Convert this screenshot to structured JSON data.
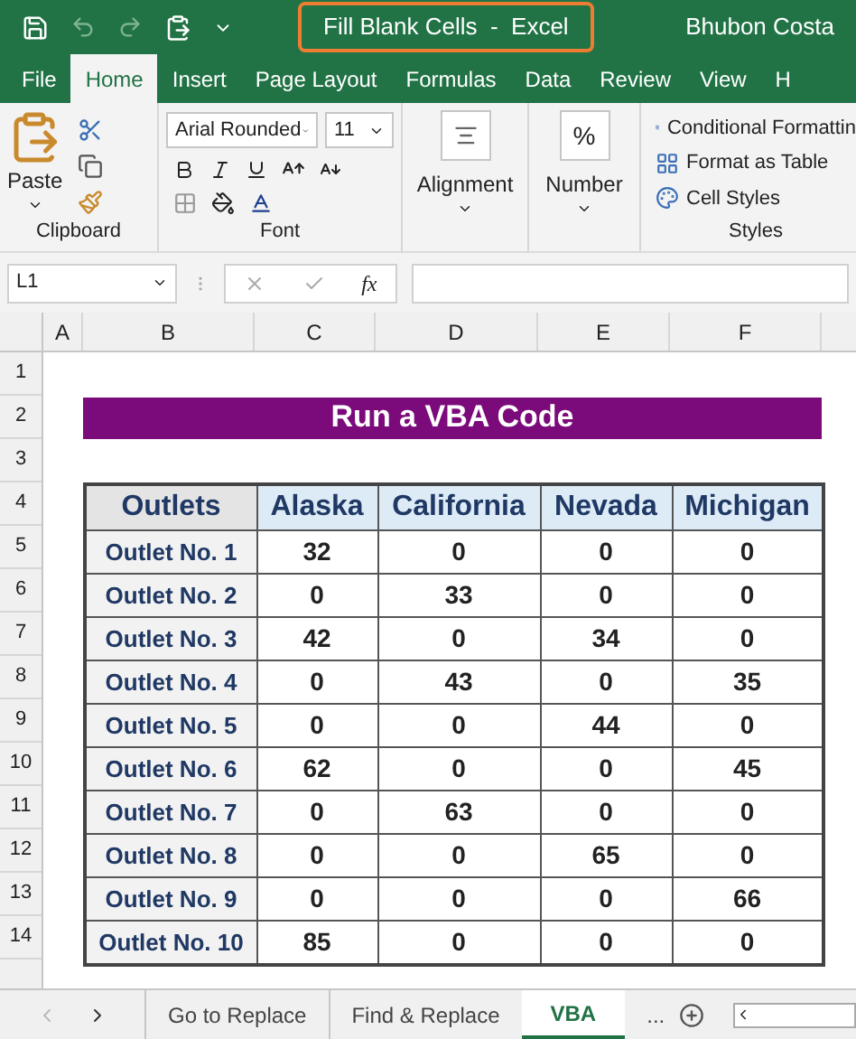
{
  "title_bar": {
    "title": "Fill Blank Cells  -  Excel",
    "user": "Bhubon Costa"
  },
  "ribbon_tabs": [
    {
      "label": "File",
      "selected": false
    },
    {
      "label": "Home",
      "selected": true
    },
    {
      "label": "Insert",
      "selected": false
    },
    {
      "label": "Page Layout",
      "selected": false
    },
    {
      "label": "Formulas",
      "selected": false
    },
    {
      "label": "Data",
      "selected": false
    },
    {
      "label": "Review",
      "selected": false
    },
    {
      "label": "View",
      "selected": false
    },
    {
      "label": "H",
      "selected": false
    }
  ],
  "ribbon": {
    "clipboard": {
      "paste": "Paste",
      "label": "Clipboard"
    },
    "font": {
      "font_name": "Arial Rounded",
      "font_size": "11",
      "label": "Font"
    },
    "alignment": {
      "label": "Alignment"
    },
    "number": {
      "symbol": "%",
      "label": "Number"
    },
    "styles": {
      "items": [
        "Conditional Formattin",
        "Format as Table",
        "Cell Styles"
      ],
      "label": "Styles"
    }
  },
  "formula_bar": {
    "name_box": "L1",
    "fx": "fx"
  },
  "column_headers": [
    "A",
    "B",
    "C",
    "D",
    "E",
    "F"
  ],
  "row_numbers": [
    "1",
    "2",
    "3",
    "4",
    "5",
    "6",
    "7",
    "8",
    "9",
    "10",
    "11",
    "12",
    "13",
    "14"
  ],
  "sheet": {
    "title": "Run a VBA Code",
    "columns": [
      "Outlets",
      "Alaska",
      "California",
      "Nevada",
      "Michigan"
    ],
    "rows": [
      [
        "Outlet No. 1",
        "32",
        "0",
        "0",
        "0"
      ],
      [
        "Outlet No. 2",
        "0",
        "33",
        "0",
        "0"
      ],
      [
        "Outlet No. 3",
        "42",
        "0",
        "34",
        "0"
      ],
      [
        "Outlet No. 4",
        "0",
        "43",
        "0",
        "35"
      ],
      [
        "Outlet No. 5",
        "0",
        "0",
        "44",
        "0"
      ],
      [
        "Outlet No. 6",
        "62",
        "0",
        "0",
        "45"
      ],
      [
        "Outlet No. 7",
        "0",
        "63",
        "0",
        "0"
      ],
      [
        "Outlet No. 8",
        "0",
        "0",
        "65",
        "0"
      ],
      [
        "Outlet No. 9",
        "0",
        "0",
        "0",
        "66"
      ],
      [
        "Outlet No. 10",
        "85",
        "0",
        "0",
        "0"
      ]
    ]
  },
  "sheet_tabs": [
    {
      "label": "Go to Replace",
      "selected": false
    },
    {
      "label": "Find & Replace",
      "selected": false
    },
    {
      "label": "VBA",
      "selected": true
    }
  ],
  "more_sheets": "..."
}
